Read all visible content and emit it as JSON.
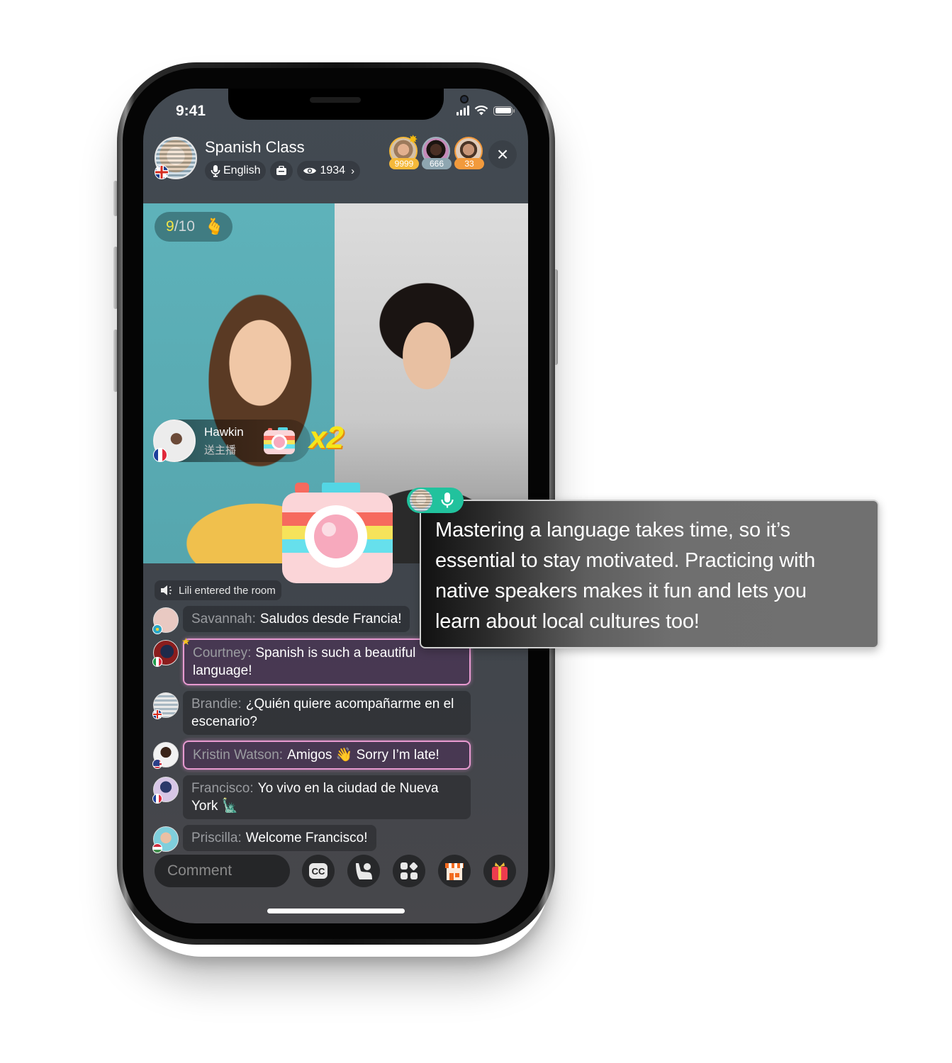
{
  "status_bar": {
    "time": "9:41"
  },
  "header": {
    "title": "Spanish Class",
    "host_flag": "uk-flag",
    "language_tag": "English",
    "viewer_count": "1934",
    "top_viewers": [
      {
        "name": "top-viewer-1",
        "count": "9999",
        "color": "#f5b93a",
        "crown": true
      },
      {
        "name": "top-viewer-2",
        "count": "666",
        "color": "#9fb3bd",
        "crown": false
      },
      {
        "name": "top-viewer-3",
        "count": "33",
        "color": "#f29a3c",
        "crown": false
      }
    ],
    "close_icon": "×"
  },
  "stage": {
    "likes_current": "9",
    "likes_total": "/10",
    "gift": {
      "sender": "Hawkin",
      "action": "送主播",
      "multiplier": "x2"
    }
  },
  "chat": {
    "system_message": "Lili entered the room",
    "messages": [
      {
        "user": "Savannah:",
        "text": "Saludos desde Francia!",
        "flag": "kz",
        "vip": false,
        "avatar": "#e9c9c2"
      },
      {
        "user": "Courtney:",
        "text": "Spanish is such a beautiful language!",
        "flag": "it",
        "vip": true,
        "avatar": "#8a1d1d"
      },
      {
        "user": "Brandie:",
        "text": "¿Quién quiere acompañarme en el escenario?",
        "flag": "uk",
        "vip": false,
        "avatar": "#c9cfd4"
      },
      {
        "user": "Kristin Watson:",
        "text": "Amigos 👋 Sorry I’m late!",
        "flag": "us",
        "vip": true,
        "avatar": "#e8e8e8"
      },
      {
        "user": "Francisco:",
        "text": "Yo vivo en la ciudad de Nueva York 🗽",
        "flag": "fr",
        "vip": false,
        "avatar": "#d7c6e6"
      },
      {
        "user": "Priscilla:",
        "text": "Welcome Francisco!",
        "flag": "hu",
        "vip": false,
        "avatar": "#7fcfdc"
      }
    ]
  },
  "bottom_bar": {
    "comment_placeholder": "Comment",
    "buttons": [
      "cc-icon",
      "raise-hand-icon",
      "apps-icon",
      "shop-icon",
      "gift-icon"
    ]
  },
  "caption": {
    "text": "Mastering a language takes time, so it’s essential to stay motivated. Practicing with native speakers makes it fun and lets you learn about local cultures too!",
    "speaker_status": "speaking"
  },
  "colors": {
    "accent_green": "#21c29d",
    "likes_yellow": "#f2e545",
    "vip_border": "#e79ad0"
  }
}
